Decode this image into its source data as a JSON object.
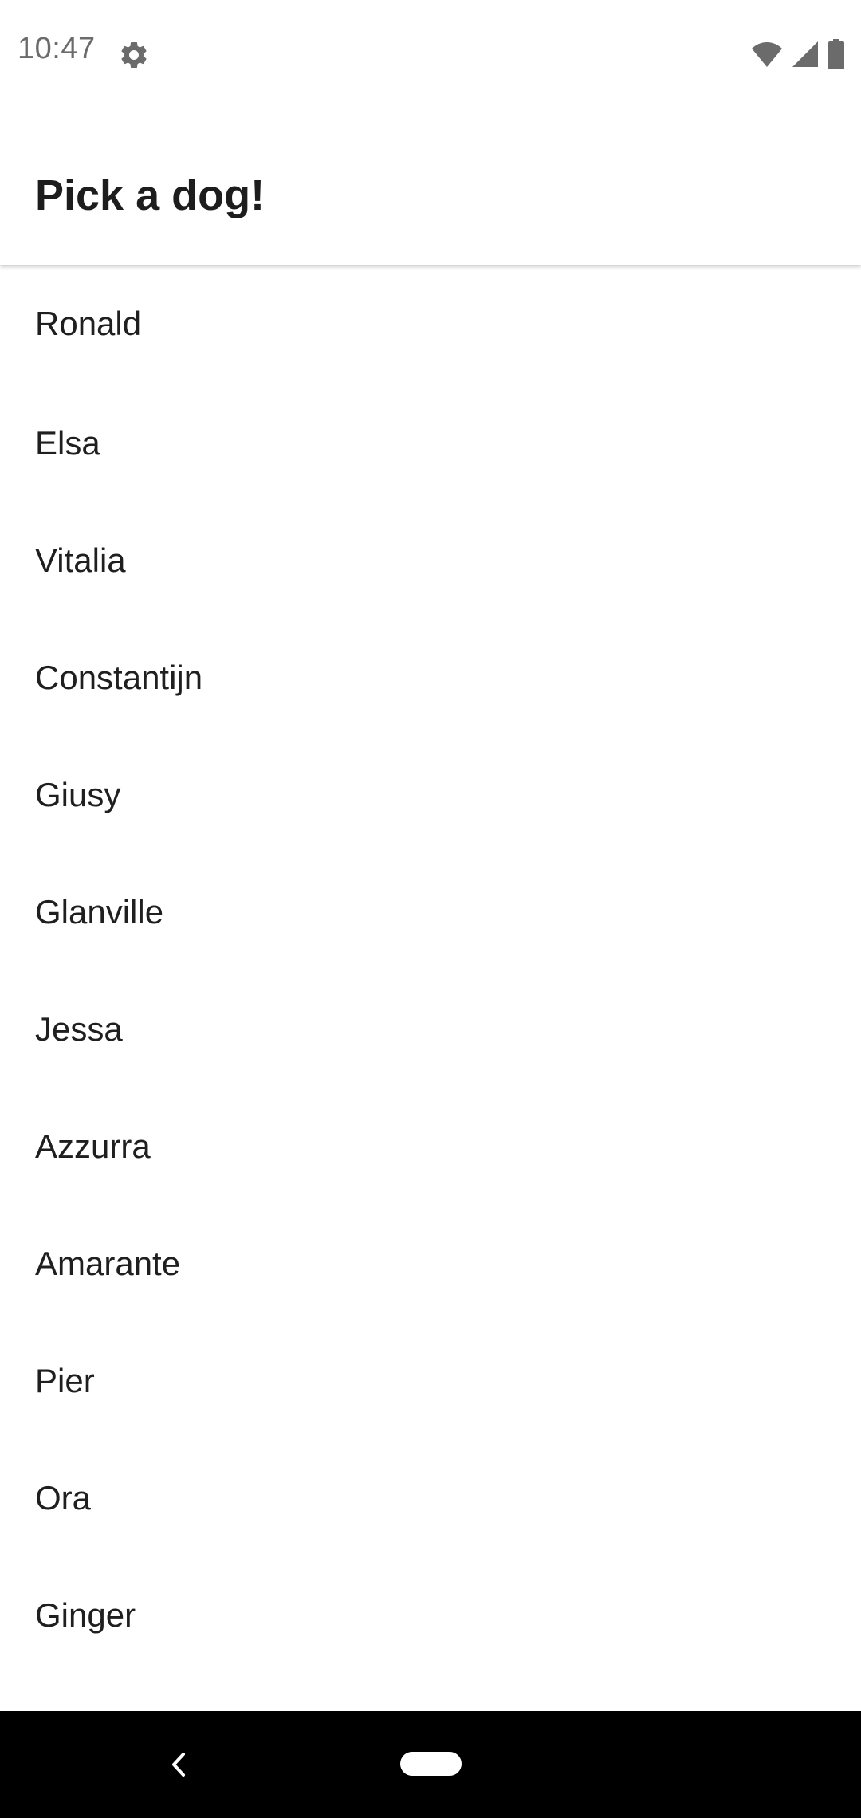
{
  "status_bar": {
    "time": "10:47",
    "icons": [
      "gear-icon",
      "wifi-icon",
      "signal-icon",
      "battery-icon"
    ]
  },
  "app_bar": {
    "title": "Pick a dog!"
  },
  "dogs": [
    "Ronald",
    "Elsa",
    "Vitalia",
    "Constantijn",
    "Giusy",
    "Glanville",
    "Jessa",
    "Azzurra",
    "Amarante",
    "Pier",
    "Ora",
    "Ginger"
  ],
  "nav_bar": {
    "icons": [
      "back-icon",
      "home-pill-icon"
    ]
  },
  "colors": {
    "background": "#ffffff",
    "text": "#1f1f1f",
    "status_text": "#6b6b6b",
    "nav_bar": "#000000"
  }
}
